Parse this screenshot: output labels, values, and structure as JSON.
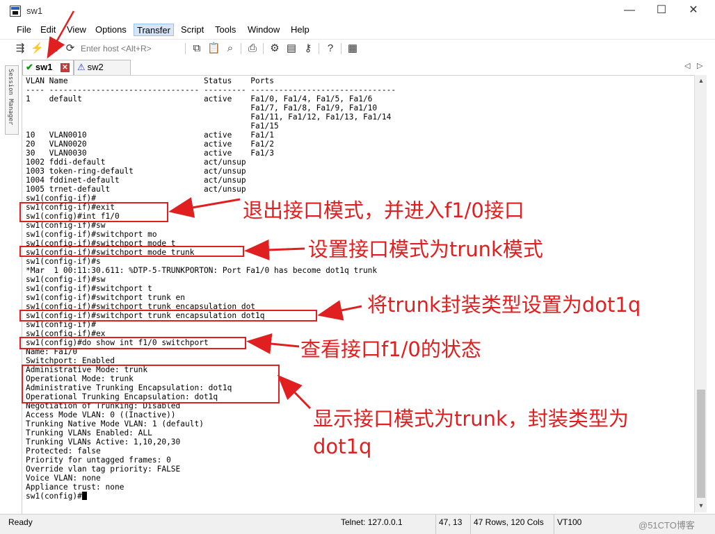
{
  "window": {
    "title": "sw1",
    "minimize": "—",
    "maximize": "☐",
    "close": "✕"
  },
  "menu": [
    "File",
    "Edit",
    "View",
    "Options",
    "Transfer",
    "Script",
    "Tools",
    "Window",
    "Help"
  ],
  "toolbar": {
    "host_placeholder": "Enter host <Alt+R>"
  },
  "session_manager": "Session Manager",
  "tabs": [
    {
      "label": "sw1",
      "status_icon": "check-icon",
      "active": true
    },
    {
      "label": "sw2",
      "status_icon": "warning-icon",
      "active": false
    }
  ],
  "terminal_lines": [
    "VLAN Name                             Status    Ports",
    "---- -------------------------------- --------- -------------------------------",
    "1    default                          active    Fa1/0, Fa1/4, Fa1/5, Fa1/6",
    "                                                Fa1/7, Fa1/8, Fa1/9, Fa1/10",
    "                                                Fa1/11, Fa1/12, Fa1/13, Fa1/14",
    "                                                Fa1/15",
    "10   VLAN0010                         active    Fa1/1",
    "20   VLAN0020                         active    Fa1/2",
    "30   VLAN0030                         active    Fa1/3",
    "1002 fddi-default                     act/unsup",
    "1003 token-ring-default               act/unsup",
    "1004 fddinet-default                  act/unsup",
    "1005 trnet-default                    act/unsup",
    "sw1(config-if)#",
    "sw1(config-if)#exit",
    "sw1(config)#int f1/0",
    "sw1(config-if)#sw",
    "sw1(config-if)#switchport mo",
    "sw1(config-if)#switchport mode t",
    "sw1(config-if)#switchport mode trunk",
    "sw1(config-if)#s",
    "*Mar  1 00:11:30.611: %DTP-5-TRUNKPORTON: Port Fa1/0 has become dot1q trunk",
    "sw1(config-if)#sw",
    "sw1(config-if)#switchport t",
    "sw1(config-if)#switchport trunk en",
    "sw1(config-if)#switchport trunk encapsulation dot",
    "sw1(config-if)#switchport trunk encapsulation dot1q",
    "sw1(config-if)#",
    "sw1(config-if)#ex",
    "sw1(config)#do show int f1/0 switchport",
    "Name: Fa1/0",
    "Switchport: Enabled",
    "Administrative Mode: trunk",
    "Operational Mode: trunk",
    "Administrative Trunking Encapsulation: dot1q",
    "Operational Trunking Encapsulation: dot1q",
    "Negotiation of Trunking: Disabled",
    "Access Mode VLAN: 0 ((Inactive))",
    "Trunking Native Mode VLAN: 1 (default)",
    "Trunking VLANs Enabled: ALL",
    "Trunking VLANs Active: 1,10,20,30",
    "Protected: false",
    "Priority for untagged frames: 0",
    "Override vlan tag priority: FALSE",
    "Voice VLAN: none",
    "Appliance trust: none",
    "sw1(config)#"
  ],
  "annotations": {
    "exit_note": "退出接口模式，并进入f1/0接口",
    "mode_note": "设置接口模式为trunk模式",
    "encap_note": "将trunk封装类型设置为dot1q",
    "show_note": "查看接口f1/0的状态",
    "result_note_line1": "显示接口模式为trunk，封装类型为",
    "result_note_line2": "dot1q"
  },
  "statusbar": {
    "ready": "Ready",
    "connection": "Telnet: 127.0.0.1",
    "cursor_pos": "47,  13",
    "size": "47 Rows, 120 Cols",
    "terminal_type": "VT100"
  },
  "watermark": "@51CTO博客",
  "colors": {
    "annotation": "#e02020",
    "ok": "#0a9a0a",
    "warning": "#1e3fc4"
  }
}
